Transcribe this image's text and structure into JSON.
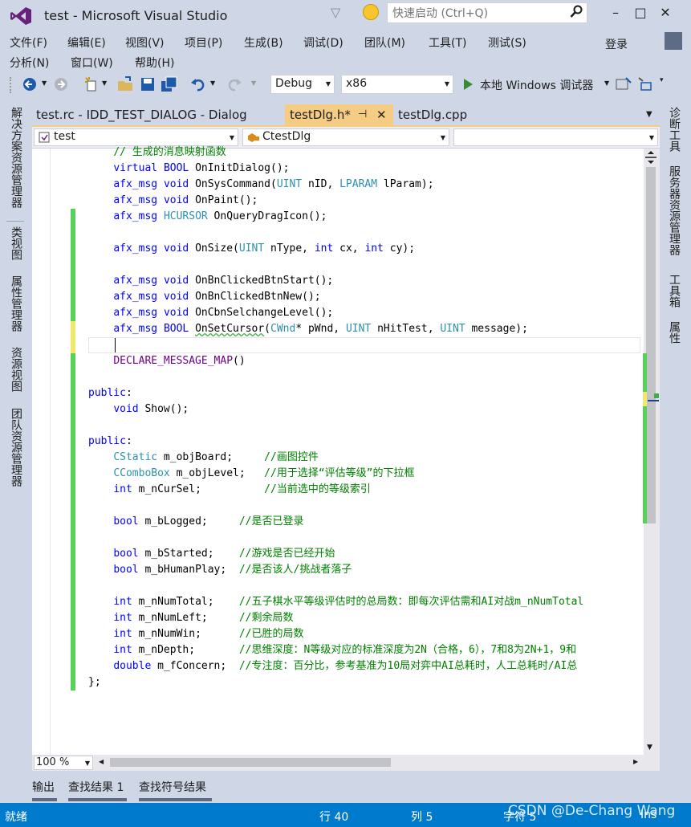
{
  "window": {
    "title": "test - Microsoft Visual Studio",
    "quick_launch_placeholder": "快速启动 (Ctrl+Q)",
    "controls": [
      "–",
      "□",
      "✕"
    ]
  },
  "menu": {
    "row1": [
      "文件(F)",
      "编辑(E)",
      "视图(V)",
      "项目(P)",
      "生成(B)",
      "调试(D)",
      "团队(M)",
      "工具(T)",
      "测试(S)"
    ],
    "row2": [
      "分析(N)",
      "窗口(W)",
      "帮助(H)"
    ],
    "login": "登录"
  },
  "toolbar": {
    "config": "Debug",
    "platform": "x86",
    "run_label": "本地 Windows 调试器"
  },
  "left_dock": [
    "解决方案资源管理器",
    "类视图",
    "属性管理器",
    "资源视图",
    "团队资源管理器"
  ],
  "right_dock": [
    "诊断工具",
    "服务器资源管理器",
    "工具箱",
    "属性"
  ],
  "doc_tabs": [
    {
      "label": "test.rc - IDD_TEST_DIALOG - Dialog"
    },
    {
      "label": "testDlg.h*"
    },
    {
      "label": "testDlg.cpp"
    }
  ],
  "nav": {
    "project": "test",
    "class": "CtestDlg",
    "member": ""
  },
  "code": {
    "l0": "// 生成的消息映射函数",
    "l1a": "virtual",
    "l1b": "BOOL",
    "l1c": " OnInitDialog();",
    "l2a": "afx_msg",
    "l2b": "void",
    "l2c": " OnSysCommand(",
    "l2d": "UINT",
    "l2e": " nID, ",
    "l2f": "LPARAM",
    "l2g": " lParam);",
    "l3a": "afx_msg",
    "l3b": "void",
    "l3c": " OnPaint();",
    "l4a": "afx_msg",
    "l4b": "HCURSOR",
    "l4c": " OnQueryDragIcon();",
    "l5a": "afx_msg",
    "l5b": "void",
    "l5c": " OnSize(",
    "l5d": "UINT",
    "l5e": " nType, ",
    "l5f": "int",
    "l5g": " cx, ",
    "l5h": "int",
    "l5i": " cy);",
    "l6a": "afx_msg",
    "l6b": "void",
    "l6c": " OnBnClickedBtnStart();",
    "l7a": "afx_msg",
    "l7b": "void",
    "l7c": " OnBnClickedBtnNew();",
    "l8a": "afx_msg",
    "l8b": "void",
    "l8c": " OnCbnSelchangeLevel();",
    "l9a": "afx_msg",
    "l9b": "BOOL",
    "l9c": "OnSetCursor",
    "l9d": "CWnd",
    "l9e": "* pWnd, ",
    "l9f": "UINT",
    "l9g": " nHitTest, ",
    "l9h": "UINT",
    "l9i": " message);",
    "l10": "DECLARE_MESSAGE_MAP",
    "l10b": "()",
    "pub1": "public",
    "show_a": "void",
    "show_b": " Show();",
    "pub2": "public",
    "m1a": "CStatic",
    "m1b": " m_objBoard;     ",
    "m1c": "//画图控件",
    "m2a": "CComboBox",
    "m2b": " m_objLevel;   ",
    "m2c": "//用于选择“评估等级”的下拉框",
    "m3a": "int",
    "m3b": " m_nCurSel;          ",
    "m3c": "//当前选中的等级索引",
    "m4a": "bool",
    "m4b": " m_bLogged;     ",
    "m4c": "//是否已登录",
    "m5a": "bool",
    "m5b": " m_bStarted;    ",
    "m5c": "//游戏是否已经开始",
    "m6a": "bool",
    "m6b": " m_bHumanPlay;  ",
    "m6c": "//是否该人/挑战者落子",
    "m7a": "int",
    "m7b": " m_nNumTotal;    ",
    "m7c": "//五子棋水平等级评估时的总局数：即每次评估需和AI对战m_nNumTotal",
    "m8a": "int",
    "m8b": " m_nNumLeft;     ",
    "m8c": "//剩余局数",
    "m9a": "int",
    "m9b": " m_nNumWin;      ",
    "m9c": "//已胜的局数",
    "m10a": "int",
    "m10b": " m_nDepth;       ",
    "m10c": "//思维深度：N等级对应的标准深度为2N（合格，6），7和8为2N+1，9和",
    "m11a": "double",
    "m11b": " m_fConcern;  ",
    "m11c": "//专注度：百分比，参考基准为10局对弈中AI总耗时，人工总耗时/AI总",
    "close": "};"
  },
  "editor": {
    "zoom": "100 %"
  },
  "bottom_tabs": [
    "输出",
    "查找结果 1",
    "查找符号结果"
  ],
  "status": {
    "ready": "就绪",
    "line": "行 40",
    "col": "列 5",
    "char": "字符 5",
    "ins": "Ins"
  },
  "watermark": "CSDN @De-Chang Wang",
  "colors": {
    "accent": "#007ACC",
    "active_tab": "#F5CC84",
    "change_saved": "#57D157",
    "change_unsaved": "#EFE86A"
  }
}
